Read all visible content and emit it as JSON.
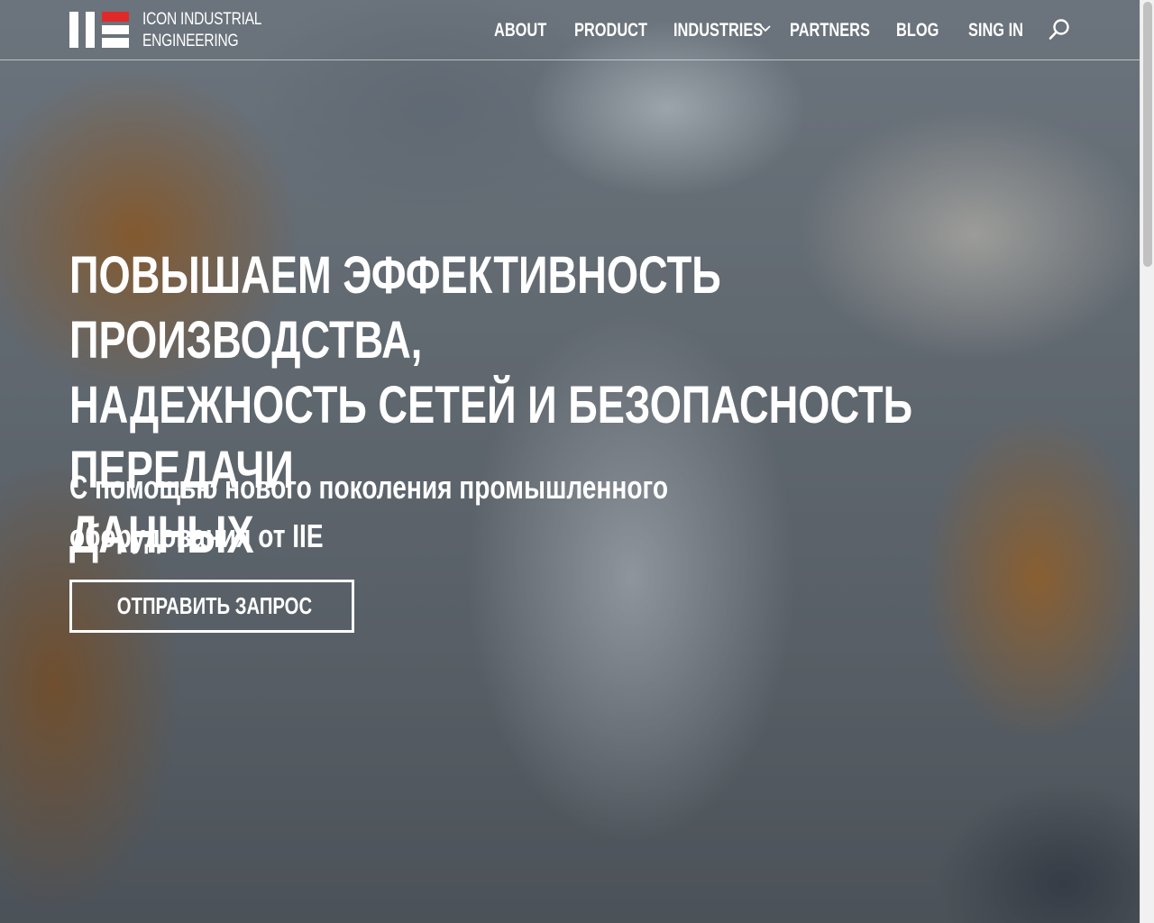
{
  "brand": {
    "line1": "ICON INDUSTRIAL",
    "line2": "ENGINEERING",
    "colors": {
      "accent_red": "#e02a2a",
      "logo_white": "#ffffff"
    }
  },
  "nav": {
    "items": [
      {
        "label": "ABOUT"
      },
      {
        "label": "PRODUCT"
      },
      {
        "label": "INDUSTRIES",
        "has_dropdown": true
      },
      {
        "label": "PARTNERS"
      },
      {
        "label": "BLOG"
      },
      {
        "label": "SING IN"
      }
    ],
    "icons": {
      "dropdown": "chevron-down-icon",
      "search": "search-icon"
    }
  },
  "hero": {
    "title_line1": "ПОВЫШАЕМ ЭФФЕКТИВНОСТЬ ПРОИЗВОДСТВА,",
    "title_line2": "НАДЕЖНОСТЬ СЕТЕЙ И БЕЗОПАСНОСТЬ ПЕРЕДАЧИ",
    "title_line3": "ДАННЫХ",
    "subtitle_line1": "С помощью нового поколения промышленного",
    "subtitle_line2": "оборудования от IIE",
    "cta_label": "ОТПРАВИТЬ ЗАПРОС",
    "background": "factory-robots-car-assembly-photo"
  }
}
